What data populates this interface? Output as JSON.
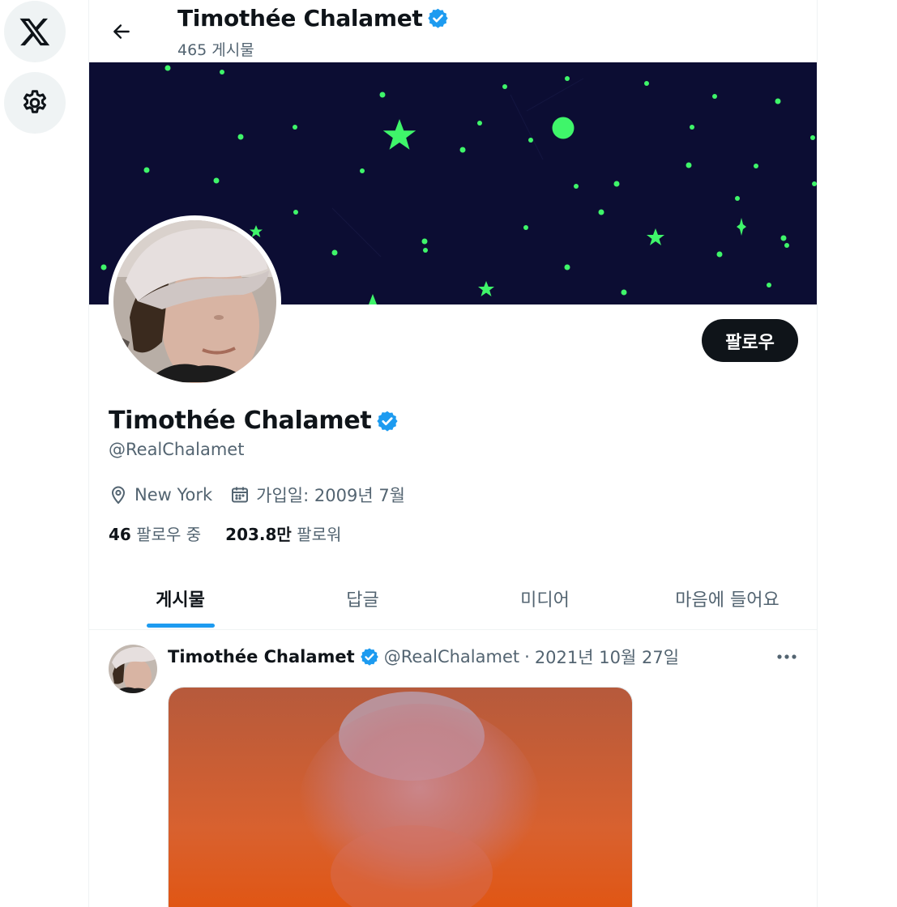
{
  "header": {
    "name": "Timothée Chalamet",
    "post_count": "465 게시물"
  },
  "profile": {
    "name": "Timothée Chalamet",
    "handle": "@RealChalamet",
    "location": "New York",
    "joined": "가입일: 2009년 7월",
    "following_count": "46",
    "following_label": "팔로우 중",
    "followers_count": "203.8만",
    "followers_label": "팔로워",
    "follow_button": "팔로우"
  },
  "tabs": [
    {
      "label": "게시물",
      "active": true
    },
    {
      "label": "답글",
      "active": false
    },
    {
      "label": "미디어",
      "active": false
    },
    {
      "label": "마음에 들어요",
      "active": false
    }
  ],
  "post": {
    "author_name": "Timothée Chalamet",
    "author_handle": "@RealChalamet",
    "separator": "·",
    "date": "2021년 10월 27일"
  },
  "icons": {
    "rail": [
      "x-logo-icon",
      "gear-icon"
    ],
    "back": "arrow-left-icon",
    "verified": "verified-badge-icon",
    "location": "map-pin-icon",
    "calendar": "calendar-icon",
    "more": "more-horizontal-icon"
  },
  "colors": {
    "accent": "#1d9bf0",
    "text_primary": "#0f1419",
    "text_secondary": "#536471",
    "follow_button_bg": "#0f1419",
    "banner_bg": "#0c0d33",
    "glow_star": "#3ff56a"
  }
}
